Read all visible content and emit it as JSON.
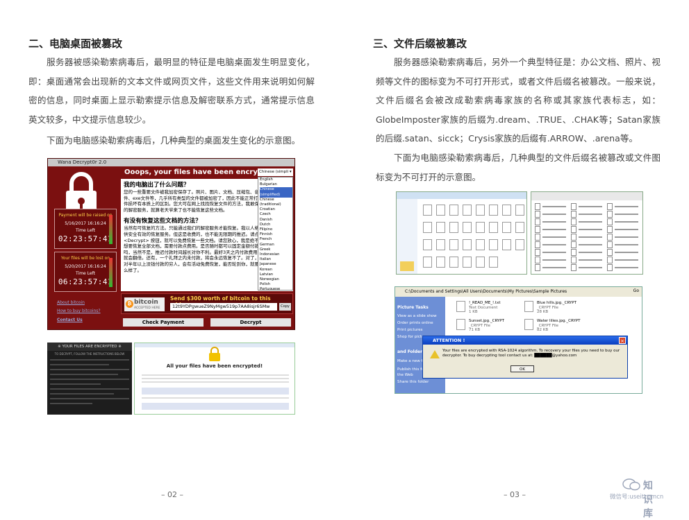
{
  "left": {
    "heading": "二、电脑桌面被篡改",
    "para1": "服务器被感染勒索病毒后，最明显的特征是电脑桌面发生明显变化，即：桌面通常会出现新的文本文件或网页文件，这些文件用来说明如何解密的信息，同时桌面上显示勒索提示信息及解密联系方式，通常提示信息英文较多，中文提示信息较少。",
    "para2": "下面为电脑感染勒索病毒后，几种典型的桌面发生变化的示意图。",
    "page_number": "– 02 –",
    "wannacry": {
      "title": "Wana Decrypt0r 2.0",
      "headline": "Ooops, your files have been encrypted!",
      "language": "Chinese (simpli ▾",
      "body_h1": "我的电脑出了什么问题？",
      "body_p1": "您的一些重要文件被我加密保存了。照片、图片、文档、压缩包、音频、视频文件、exe文件等，几乎所有类型的文件都被加密了，因此不能正常打开。这和一般文件损坏有本质上的区别。您大可在网上找找恢复文件的方法，我敢保证，没有我们的解密服务，就算老天爷来了也不能恢复这些文档。",
      "body_h2": "有没有恢复这些文档的方法？",
      "body_p2": "当然有可恢复的方法。只能通过我们的解密服务才能恢复。我以人格担保，能够提供安全有效的恢复服务。但这是收费的，也不能无限期的推迟。请点击 <Decrypt> 按钮，就可以免费恢复一些文档。请您放心，我是绝不会骗你的。但想要恢复全部文档，需要付款点费用。是否随时都可以固定金额付款，就会恢复的吗，当然不是，推迟付款时间越长对你不利。最好3天之内付款费用，过了三天费用就会翻倍。还有，一个礼拜之内未付款，将会永远恢复不了。对了，忘了告诉你，对半年以上没钱付款的穷人，会有活动免费恢复，能否轮到你，就要看你的运气怎么样了。",
      "languages": [
        "English",
        "Bulgarian",
        "Chinese (simplified)",
        "Chinese (traditional)",
        "Croatian",
        "Czech",
        "Danish",
        "Dutch",
        "Filipino",
        "Finnish",
        "French",
        "German",
        "Greek",
        "Indonesian",
        "Italian",
        "Japanese",
        "Korean",
        "Latvian",
        "Norwegian",
        "Polish",
        "Portuguese",
        "Romanian",
        "Russian",
        "Slovak",
        "Spanish",
        "Swedish",
        "Turkish",
        "Vietnamese"
      ],
      "box1": {
        "label": "Payment will be raised on",
        "date": "5/16/2017 16:16:24",
        "time_left": "Time Left",
        "countdown": "02:23:57:41"
      },
      "box2": {
        "label": "Your files will be lost on",
        "date": "5/20/2017 16:16:24",
        "time_left": "Time Left",
        "countdown": "06:23:57:41"
      },
      "link1": "About bitcoin",
      "link2": "How to buy bitcoins?",
      "link3": "Contact Us",
      "bitcoin_logo": "bitcoin",
      "bitcoin_accepted": "ACCEPTED HERE",
      "send": "Send $300 worth of bitcoin to this address:",
      "address": "12t9YDPgwueZ9NyMgw519p7AA8isjr6SMw",
      "copy": "Copy",
      "check_payment": "Check Payment",
      "decrypt": "Decrypt"
    },
    "shot2": {
      "header": "※ YOUR FILES ARE ENCRYPTED ※",
      "sub": "TO DECRYPT, FOLLOW THE INSTRUCTIONS BELOW"
    },
    "shot3": {
      "title": "All your files have been encrypted!"
    }
  },
  "right": {
    "heading": "三、文件后缀被篡改",
    "para1": "服务器感染勒索病毒后，另外一个典型特征是：办公文档、照片、视频等文件的图标变为不可打开形式，或者文件后缀名被篡改。一般来说，文件后缀名会被改成勒索病毒家族的名称或其家族代表标志，如：GlobeImposter家族的后缀为.dream、.TRUE、.CHAK等；Satan家族的后缀.satan、sicck；Crysis家族的后缀有.ARROW、.arena等。",
    "para2": "下面为电脑感染勒索病毒后，几种典型的文件后缀名被篡改或文件图标变为不可打开的示意图。",
    "page_number": "– 03 –",
    "explorer": {
      "address": "C:\\Documents and Settings\\All Users\\Documents\\My Pictures\\Sample Pictures",
      "go": "Go",
      "tasks": [
        "Picture Tasks",
        "View as a slide show",
        "Order prints online",
        "Print pictures",
        "Shop for pictures",
        "and Folder Ta",
        "Make a new fo",
        "Publish this fo",
        "the Web",
        "Share this folder"
      ],
      "files": [
        {
          "name": "!_READ_ME_!.txt",
          "type": "Text Document",
          "size": "1 KB"
        },
        {
          "name": "Blue hills.jpg._CRYPT",
          "type": "_CRYPT File",
          "size": "28 KB"
        },
        {
          "name": "Sunset.jpg._CRYPT",
          "type": "_CRYPT File",
          "size": "71 KB"
        },
        {
          "name": "Water lilies.jpg._CRYPT",
          "type": "_CRYPT File",
          "size": "82 KB"
        }
      ]
    },
    "dialog": {
      "caption": "ATTENTION !",
      "message": "Your files are encrypted with RSA-1024 algorithm. To recovery your files you need to buy our decryptor. To buy decrypting tool contact us at: ██████@yahoo.com",
      "ok": "OK"
    }
  },
  "watermark": {
    "name": "知识库",
    "sub": "微信号:useitcomcn"
  }
}
